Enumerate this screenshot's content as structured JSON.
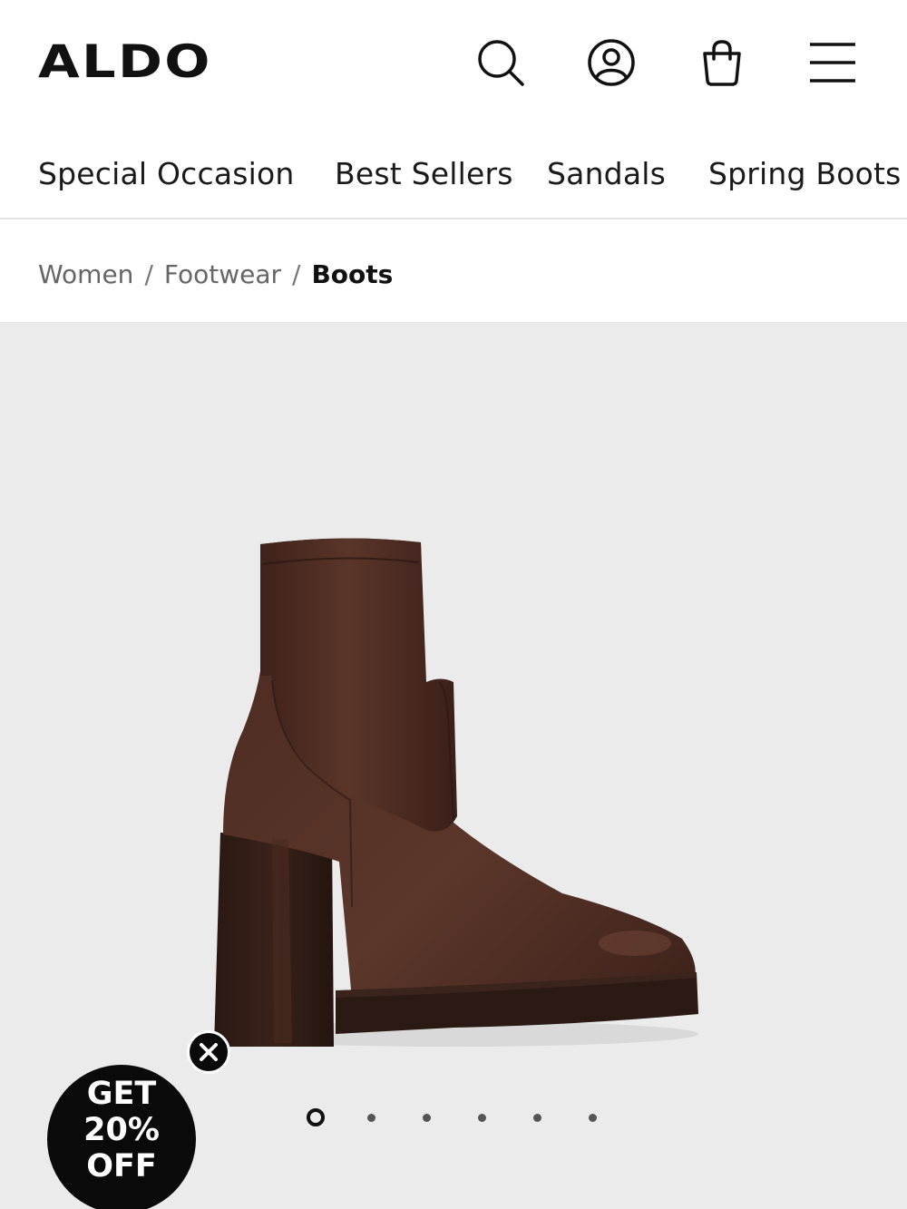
{
  "header": {
    "logo_text": "ALDO",
    "icons": [
      "search-icon",
      "account-icon",
      "bag-icon",
      "menu-icon"
    ]
  },
  "nav": {
    "items": [
      {
        "label": "Special Occasion"
      },
      {
        "label": "Best Sellers"
      },
      {
        "label": "Sandals"
      },
      {
        "label": "Spring Boots"
      }
    ]
  },
  "breadcrumb": {
    "items": [
      "Women",
      "Footwear"
    ],
    "current": "Boots",
    "separator": "/"
  },
  "gallery": {
    "image_count": 6,
    "active_index": 0,
    "background": "#ebebeb",
    "product_color": "#4a2a22"
  },
  "promo": {
    "line1": "GET",
    "line2": "20%",
    "line3": "OFF",
    "close_icon": "close-icon"
  }
}
